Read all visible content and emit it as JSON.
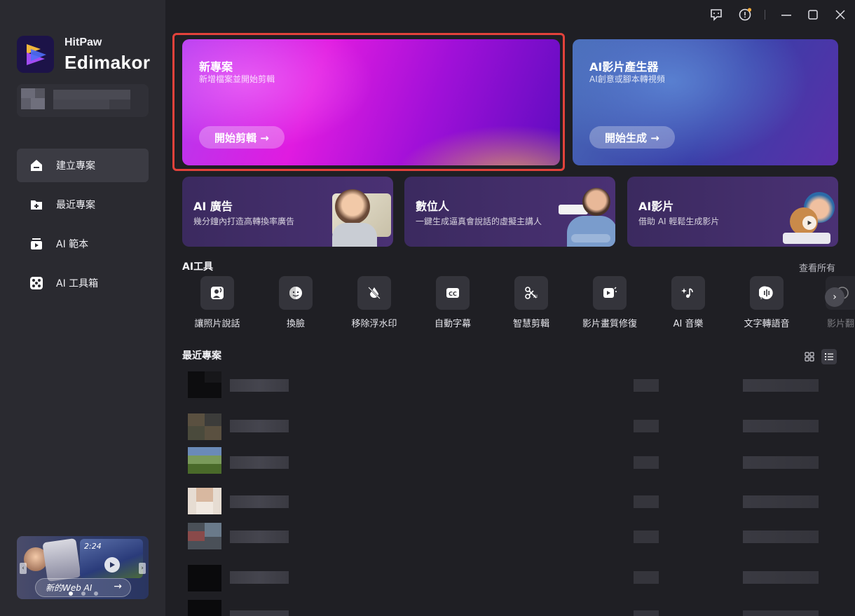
{
  "app": {
    "brand_small": "HitPaw",
    "brand_big": "Edimakor"
  },
  "sidebar": {
    "items": [
      {
        "label": "建立專案",
        "icon": "home-icon",
        "active": true
      },
      {
        "label": "最近專案",
        "icon": "folder-icon",
        "active": false
      },
      {
        "label": "AI 範本",
        "icon": "template-icon",
        "active": false
      },
      {
        "label": "AI 工具箱",
        "icon": "toolbox-icon",
        "active": false
      }
    ],
    "promo": {
      "label": "新的Web AI",
      "timestamp": "2:24",
      "arrow": "→"
    }
  },
  "titlebar": {
    "icons": [
      "feedback-icon",
      "notification-icon",
      "minimize-icon",
      "maximize-icon",
      "close-icon"
    ]
  },
  "cards": {
    "new_project": {
      "title": "新專案",
      "subtitle": "新增檔案並開始剪輯",
      "button": "開始剪輯 →"
    },
    "ai_video_generator": {
      "title": "AI影片產生器",
      "subtitle": "AI創意或腳本轉視頻",
      "button": "開始生成 →"
    }
  },
  "features": [
    {
      "title": "AI 廣告",
      "subtitle": "幾分鐘內打造高轉換率廣告"
    },
    {
      "title": "數位人",
      "subtitle": "一鍵生成逼真會說話的虛擬主講人"
    },
    {
      "title": "AI影片",
      "subtitle": "借助 AI 輕鬆生成影片"
    }
  ],
  "ai_tools": {
    "title": "AI工具",
    "see_all": "查看所有",
    "items": [
      {
        "label": "讓照片說話",
        "icon": "talking-photo-icon"
      },
      {
        "label": "換臉",
        "icon": "face-swap-icon"
      },
      {
        "label": "移除浮水印",
        "icon": "watermark-remove-icon"
      },
      {
        "label": "自動字幕",
        "icon": "subtitle-icon"
      },
      {
        "label": "智慧剪輯",
        "icon": "smart-cut-icon"
      },
      {
        "label": "影片畫質修復",
        "icon": "video-enhance-icon"
      },
      {
        "label": "AI 音樂",
        "icon": "music-icon"
      },
      {
        "label": "文字轉語音",
        "icon": "text-to-speech-icon"
      },
      {
        "label": "影片翻",
        "icon": "translate-icon"
      }
    ]
  },
  "recent": {
    "title": "最近專案"
  },
  "colors": {
    "highlight": "#e2423b",
    "sidebar_bg": "#2a2a30",
    "main_bg": "#1f1f24"
  }
}
